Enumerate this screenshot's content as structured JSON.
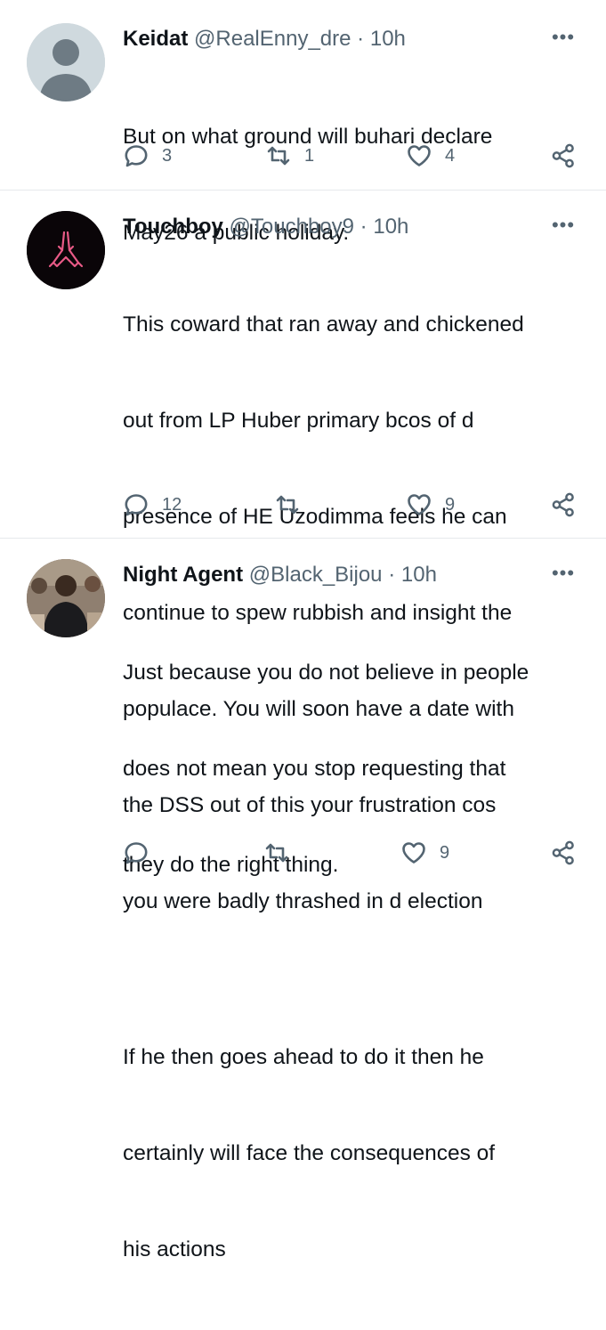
{
  "tweets": [
    {
      "name": "Keidat",
      "handle": "@RealEnny_dre",
      "sep": "·",
      "time": "10h",
      "more": "•••",
      "lines": [
        "But on what ground will buhari declare",
        "May26 a public holiday."
      ],
      "replies": "3",
      "retweets": "1",
      "likes": "4",
      "avatar": "default-avatar"
    },
    {
      "name": "Touchboy",
      "handle": "@Touchboy9",
      "sep": "·",
      "time": "10h",
      "more": "•••",
      "lines": [
        "This coward that ran away and chickened",
        "out from LP Huber primary bcos of d",
        "presence of HE Uzodimma feels he can",
        "continue to spew rubbish and insight the",
        "populace. You will soon have a date with",
        "the DSS out of this your frustration cos",
        "you were badly thrashed in d election"
      ],
      "replies": "12",
      "retweets": "",
      "likes": "9",
      "avatar": "praying-hands-avatar"
    },
    {
      "name": "Night Agent",
      "handle": "@Black_Bijou",
      "sep": "·",
      "time": "10h",
      "more": "•••",
      "lines": [
        "Just because you do not believe in people",
        "does not mean you stop requesting that",
        "they do the right thing.",
        "",
        "If he then goes ahead to do it then he",
        "certainly will face the consequences of",
        "his actions"
      ],
      "replies": "",
      "retweets": "",
      "likes": "9",
      "avatar": "photo-avatar"
    }
  ],
  "colors": {
    "text": "#0f1419",
    "secondary": "#536471",
    "divider": "#e6e9ec"
  }
}
